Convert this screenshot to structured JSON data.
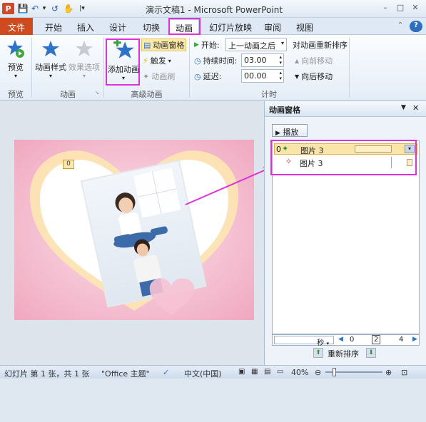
{
  "window": {
    "app_icon": "P",
    "title": "演示文稿1 - Microsoft PowerPoint",
    "controls": [
      "–",
      "□",
      "✕"
    ]
  },
  "quick_access": [
    "💾",
    "↶",
    "▾",
    "↺",
    "✋",
    "|▾"
  ],
  "tabs": [
    {
      "label": "文件"
    },
    {
      "label": "开始"
    },
    {
      "label": "插入"
    },
    {
      "label": "设计"
    },
    {
      "label": "切换"
    },
    {
      "label": "动画"
    },
    {
      "label": "幻灯片放映"
    },
    {
      "label": "审阅"
    },
    {
      "label": "视图"
    }
  ],
  "ribbon": {
    "preview": {
      "button": "预览",
      "group": "预览"
    },
    "animation": {
      "styles": "动画样式",
      "effects": "效果选项",
      "group": "动画"
    },
    "advanced": {
      "add": "添加动画",
      "pane": "动画窗格",
      "trigger": "触发",
      "painter": "动画刷",
      "group": "高级动画"
    },
    "timing": {
      "start_label": "开始:",
      "start_value": "上一动画之后",
      "duration_label": "持续时间:",
      "duration_value": "03.00",
      "delay_label": "延迟:",
      "delay_value": "00.00",
      "reorder_title": "对动画重新排序",
      "move_earlier": "向前移动",
      "move_later": "向后移动",
      "group": "计时"
    }
  },
  "slide": {
    "badge": "0"
  },
  "pane": {
    "title": "动画窗格",
    "play": "播放",
    "items": [
      {
        "index": "0",
        "label": "图片 3"
      },
      {
        "index": "",
        "label": "图片 3"
      }
    ],
    "seconds": "秒",
    "timeline": [
      "0",
      "2",
      "4"
    ],
    "reorder": "重新排序"
  },
  "status": {
    "slide_info": "幻灯片 第 1 张，共 1 张",
    "theme": "\"Office 主题\"",
    "language": "中文(中国)",
    "zoom": "40%"
  },
  "colors": {
    "accent": "#e030d8",
    "file_tab": "#d04a1f",
    "slide_pink": "#f2a9c2"
  }
}
